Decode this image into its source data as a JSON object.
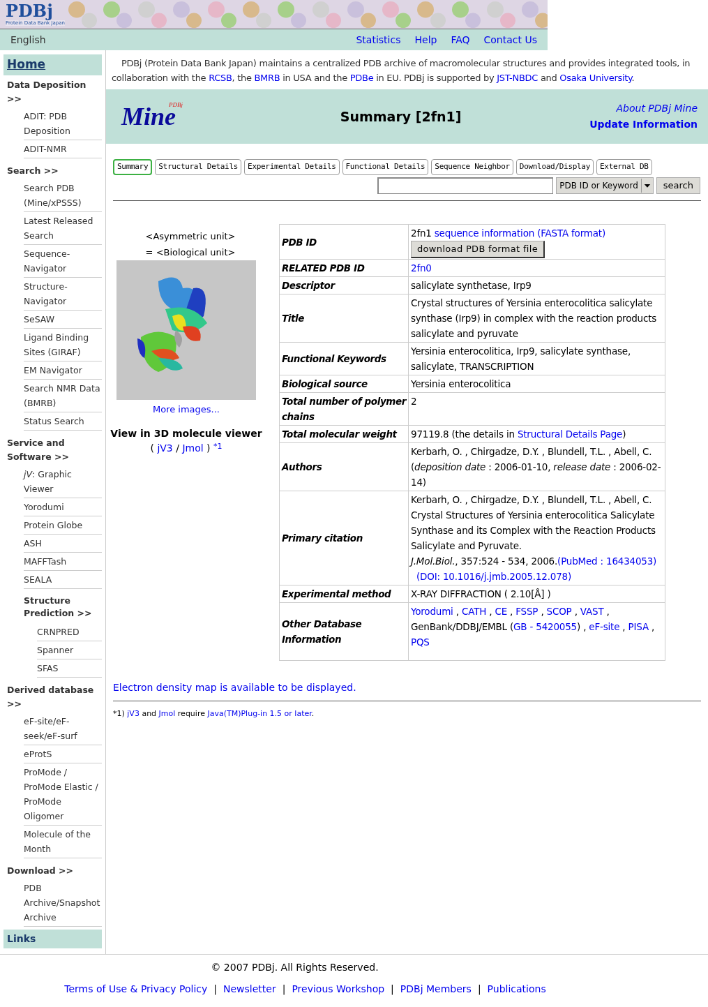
{
  "header": {
    "logo": "PDBj",
    "logo_subtitle": "Protein Data Bank Japan",
    "language": "English",
    "nav": [
      "Statistics",
      "Help",
      "FAQ",
      "Contact Us"
    ]
  },
  "sidebar": {
    "home": "Home",
    "sections": [
      {
        "title": "Data Deposition >>",
        "items": [
          {
            "label": "ADIT: PDB Deposition"
          },
          {
            "label": "ADIT-NMR"
          }
        ]
      },
      {
        "title": "Search >>",
        "items": [
          {
            "label": "Search PDB (Mine/xPSSS)"
          },
          {
            "label": "Latest Released Search"
          },
          {
            "label": "Sequence-Navigator"
          },
          {
            "label": "Structure-Navigator"
          },
          {
            "label": "SeSAW"
          },
          {
            "label": "Ligand Binding Sites (GIRAF)"
          },
          {
            "label": "EM Navigator"
          },
          {
            "label": "Search NMR Data (BMRB)"
          },
          {
            "label": "Status Search"
          }
        ]
      },
      {
        "title": "Service and Software >>",
        "items": [
          {
            "label": "*jV*: Graphic Viewer"
          },
          {
            "label": "Yorodumi"
          },
          {
            "label": "Protein Globe"
          },
          {
            "label": "ASH"
          },
          {
            "label": "MAFFTash"
          },
          {
            "label": "SEALA"
          },
          {
            "label": "Structure Prediction >>",
            "children": [
              {
                "label": "CRNPRED"
              },
              {
                "label": "Spanner"
              },
              {
                "label": "SFAS"
              }
            ]
          }
        ]
      },
      {
        "title": "Derived database >>",
        "items": [
          {
            "label": "eF-site/eF-seek/eF-surf"
          },
          {
            "label": "eProtS"
          },
          {
            "label": "ProMode / ProMode Elastic / ProMode Oligomer"
          },
          {
            "label": "Molecule of the Month"
          }
        ]
      },
      {
        "title": "Download >>",
        "items": [
          {
            "label": "PDB Archive/Snapshot Archive"
          }
        ]
      }
    ],
    "links": "Links"
  },
  "intro": [
    {
      "text": "PDBj (Protein Data Bank Japan) maintains a centralized PDB archive of macromolecular structures and provides integrated tools, in collaboration with the "
    },
    {
      "text": "RCSB",
      "kind": "link"
    },
    {
      "text": ", the "
    },
    {
      "text": "BMRB",
      "kind": "link"
    },
    {
      "text": " in USA and the "
    },
    {
      "text": "PDBe",
      "kind": "link"
    },
    {
      "text": " in EU. PDBj is supported by "
    },
    {
      "text": "JST-NBDC",
      "kind": "link"
    },
    {
      "text": " and "
    },
    {
      "text": "Osaka University",
      "kind": "link"
    },
    {
      "text": "."
    }
  ],
  "mine_header": {
    "logo": "Mine",
    "logo_badge": "PDBj",
    "title": "Summary [2fn1]",
    "links": [
      "About PDBj Mine",
      "Update Information"
    ]
  },
  "tabs": [
    {
      "label": "Summary",
      "selected": true
    },
    {
      "label": "Structural Details",
      "selected": false
    },
    {
      "label": "Experimental Details",
      "selected": false
    },
    {
      "label": "Functional Details",
      "selected": false
    },
    {
      "label": "Sequence Neighbor",
      "selected": false
    },
    {
      "label": "Download/Display",
      "selected": false
    },
    {
      "label": "External DB",
      "selected": false
    }
  ],
  "search": {
    "mode": "PDB ID or Keyword",
    "button": "search"
  },
  "image_panel": {
    "captions": [
      "<Asymmetric unit>",
      "= <Biological unit>"
    ],
    "more": "More images...",
    "viewer_title": "View in 3D molecule viewer",
    "viewer_links": [
      {
        "text": "( "
      },
      {
        "text": "jV3",
        "kind": "link"
      },
      {
        "text": " / "
      },
      {
        "text": "Jmol",
        "kind": "link"
      },
      {
        "text": " ) "
      },
      {
        "text": "*1",
        "kind": "note"
      }
    ]
  },
  "table": {
    "rows": [
      {
        "label": "PDB ID",
        "lines": [
          [
            {
              "text": "2fn1 "
            },
            {
              "text": "sequence information (FASTA format)",
              "kind": "link"
            }
          ],
          [
            {
              "text": "download PDB format file",
              "kind": "button"
            }
          ]
        ]
      },
      {
        "label": "RELATED PDB ID",
        "lines": [
          [
            {
              "text": "2fn0",
              "kind": "link"
            }
          ]
        ]
      },
      {
        "label": "Descriptor",
        "lines": [
          [
            {
              "text": "salicylate synthetase, Irp9"
            }
          ]
        ]
      },
      {
        "label": "Title",
        "lines": [
          [
            {
              "text": "Crystal structures of Yersinia enterocolitica salicylate synthase (Irp9) in complex with the reaction products salicylate and pyruvate"
            }
          ]
        ]
      },
      {
        "label": "Functional Keywords",
        "lines": [
          [
            {
              "text": "Yersinia enterocolitica, Irp9, salicylate synthase, salicylate, TRANSCRIPTION"
            }
          ]
        ]
      },
      {
        "label": "Biological source",
        "lines": [
          [
            {
              "text": "Yersinia enterocolitica"
            }
          ]
        ]
      },
      {
        "label": "Total number of polymer chains",
        "lines": [
          [
            {
              "text": "2"
            }
          ]
        ]
      },
      {
        "label": "Total molecular weight",
        "lines": [
          [
            {
              "text": "97119.8 (the details in "
            },
            {
              "text": "Structural Details Page",
              "kind": "link"
            },
            {
              "text": ")"
            }
          ]
        ]
      },
      {
        "label": "Authors",
        "lines": [
          [
            {
              "text": "Kerbarh, O. , Chirgadze, D.Y. , Blundell, T.L. , Abell, C. (*deposition date* : 2006-01-10, *release date* : 2006-02-14)"
            }
          ]
        ]
      },
      {
        "label": "Primary citation",
        "lines": [
          [
            {
              "text": "Kerbarh, O. , Chirgadze, D.Y. , Blundell, T.L. , Abell, C."
            }
          ],
          [
            {
              "text": "Crystal Structures of Yersinia enterocolitica Salicylate Synthase and its Complex with the Reaction Products Salicylate and Pyruvate."
            }
          ],
          [
            {
              "text": "*J.Mol.Biol.*, 357:524 - 534, 2006."
            },
            {
              "text": "(PubMed : 16434053)",
              "kind": "link"
            },
            {
              "text": "(DOI: 10.1016/j.jmb.2005.12.078)",
              "kind": "link"
            }
          ]
        ]
      },
      {
        "label": "Experimental method",
        "lines": [
          [
            {
              "text": "X-RAY DIFFRACTION ( 2.10[Å] )"
            }
          ]
        ]
      },
      {
        "label": "Other Database Information",
        "lines": [
          [
            {
              "text": "Yorodumi",
              "kind": "link"
            },
            {
              "text": " , "
            },
            {
              "text": "CATH",
              "kind": "link"
            },
            {
              "text": " , "
            },
            {
              "text": "CE",
              "kind": "link"
            },
            {
              "text": " , "
            },
            {
              "text": "FSSP",
              "kind": "link"
            },
            {
              "text": " , "
            },
            {
              "text": "SCOP",
              "kind": "link"
            },
            {
              "text": " , "
            },
            {
              "text": "VAST",
              "kind": "link"
            },
            {
              "text": " , GenBank/DDBJ/EMBL ("
            },
            {
              "text": "GB - 5420055",
              "kind": "link"
            },
            {
              "text": ") , "
            },
            {
              "text": "eF-site",
              "kind": "link"
            },
            {
              "text": " , "
            },
            {
              "text": "PISA",
              "kind": "link"
            },
            {
              "text": " , "
            },
            {
              "text": "PQS",
              "kind": "link"
            }
          ]
        ]
      }
    ]
  },
  "density_link": "Electron density map is available to be displayed.",
  "footnote": [
    {
      "text": "*1) "
    },
    {
      "text": "jV3",
      "kind": "link"
    },
    {
      "text": " and "
    },
    {
      "text": "Jmol",
      "kind": "link"
    },
    {
      "text": " require "
    },
    {
      "text": "Java(TM)Plug-in 1.5 or later",
      "kind": "link"
    },
    {
      "text": "."
    }
  ],
  "footer": {
    "copyright": "© 2007 PDBj. All Rights Reserved.",
    "items": [
      {
        "text": "Terms of Use & Privacy Policy",
        "kind": "link"
      },
      {
        "text": "|",
        "kind": "sep"
      },
      {
        "text": "Newsletter",
        "kind": "link"
      },
      {
        "text": "|",
        "kind": "sep"
      },
      {
        "text": "Previous Workshop",
        "kind": "link"
      },
      {
        "text": "|",
        "kind": "sep"
      },
      {
        "text": "PDBj Members",
        "kind": "link"
      },
      {
        "text": "|",
        "kind": "sep"
      },
      {
        "text": "Publications",
        "kind": "link"
      }
    ]
  }
}
